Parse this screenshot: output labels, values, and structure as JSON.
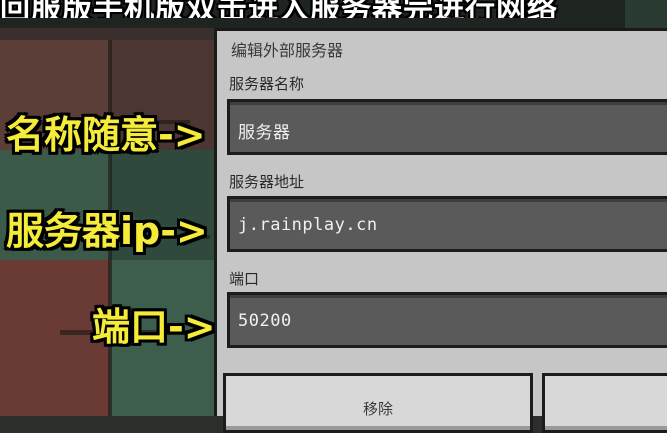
{
  "top_caption": "回服版手机版双击进入服务器完进行网络",
  "dialog": {
    "title": "编辑外部服务器",
    "fields": [
      {
        "label": "服务器名称",
        "value": "服务器"
      },
      {
        "label": "服务器地址",
        "value": "j.rainplay.cn"
      },
      {
        "label": "端口",
        "value": "50200"
      }
    ],
    "buttons": {
      "remove": "移除",
      "other": ""
    }
  },
  "annotations": [
    "名称随意->",
    "服务器ip->",
    "端口->"
  ],
  "colors": {
    "annotation_text": "#f5ec3a",
    "dialog_bg": "#c6c6c6",
    "field_bg": "#5a5a5a"
  }
}
